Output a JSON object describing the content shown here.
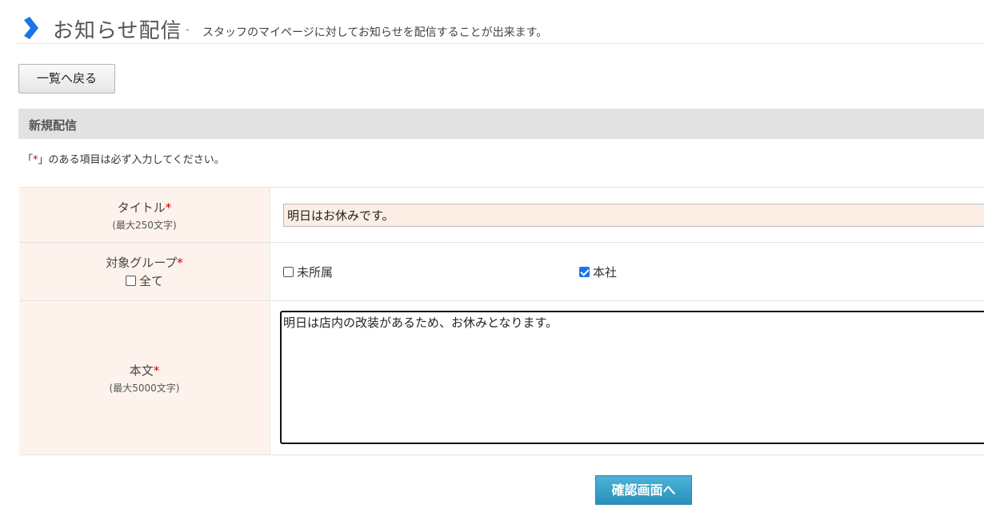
{
  "header": {
    "title": "お知らせ配信",
    "separator": "-",
    "description": "スタッフのマイページに対してお知らせを配信することが出来ます。",
    "accent_color": "#1a73e8"
  },
  "back_button": {
    "label": "一覧へ戻る"
  },
  "section": {
    "title": "新規配信"
  },
  "note": {
    "prefix": "「",
    "mark": "*",
    "suffix": "」のある項目は必ず入力してください。"
  },
  "form": {
    "title_field": {
      "label": "タイトル",
      "required_mark": "*",
      "hint": "(最大250文字)",
      "value": "明日はお休みです。"
    },
    "group_field": {
      "label": "対象グループ",
      "required_mark": "*",
      "all_label": "全て",
      "all_checked": false,
      "options": [
        {
          "label": "未所属",
          "checked": false
        },
        {
          "label": "本社",
          "checked": true
        }
      ]
    },
    "body_field": {
      "label": "本文",
      "required_mark": "*",
      "hint": "(最大5000文字)",
      "value": "明日は店内の改装があるため、お休みとなります。"
    }
  },
  "confirm_button": {
    "label": "確認画面へ"
  }
}
